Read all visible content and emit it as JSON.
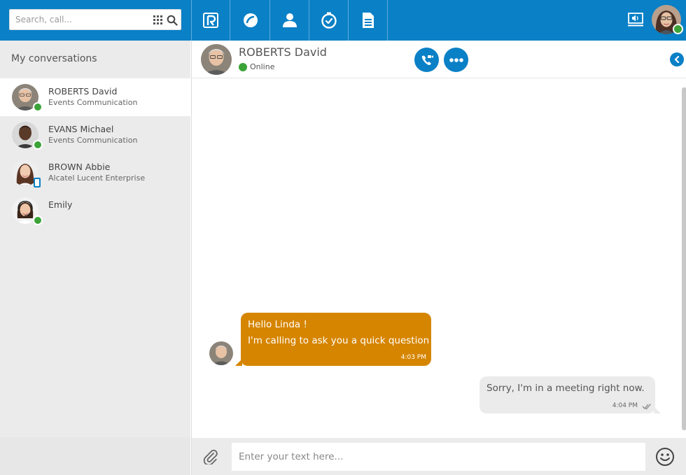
{
  "search": {
    "placeholder": "Search, call..."
  },
  "nav": {
    "items": [
      {
        "icon": "rainbow-logo-icon"
      },
      {
        "icon": "bubble-icon"
      },
      {
        "icon": "contacts-icon"
      },
      {
        "icon": "clock-icon"
      },
      {
        "icon": "document-icon"
      }
    ],
    "right": {
      "screen_icon": "screen-share-icon",
      "user_status": "online"
    }
  },
  "sidebar": {
    "title": "My conversations",
    "conversations": [
      {
        "name": "ROBERTS David",
        "company": "Events Communication",
        "status": "online",
        "active": true
      },
      {
        "name": "EVANS Michael",
        "company": "Events Communication",
        "status": "online",
        "active": false
      },
      {
        "name": "BROWN Abbie",
        "company": "Alcatel Lucent Enterprise",
        "status": "mobile",
        "active": false
      },
      {
        "name": "Emily",
        "company": "",
        "status": "online",
        "active": false
      }
    ]
  },
  "chat": {
    "contact_name": "ROBERTS David",
    "contact_status": "Online",
    "messages": [
      {
        "direction": "in",
        "line1": "Hello Linda !",
        "line2": "I'm calling to ask you a quick question",
        "time": "4:03 PM"
      },
      {
        "direction": "out",
        "text": "Sorry, I'm in a meeting right now.",
        "time": "4:04 PM"
      }
    ],
    "composer_placeholder": "Enter your text here..."
  },
  "colors": {
    "brand": "#0a80c6",
    "incoming_bubble": "#d68500",
    "outgoing_bubble": "#ebebeb",
    "online": "#3ba338"
  }
}
